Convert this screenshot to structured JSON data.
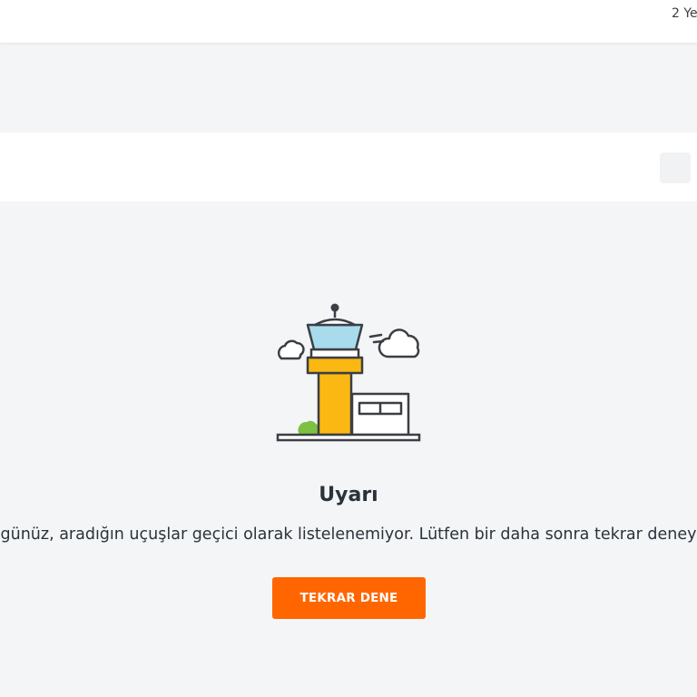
{
  "header": {
    "right_text": "2 Ye"
  },
  "warning": {
    "title": "Uyarı",
    "message": "günüz, aradığın uçuşlar geçici olarak listelenemiyor. Lütfen bir daha sonra tekrar deney",
    "retry_label": "TEKRAR DENE"
  },
  "illustration": {
    "icon": "control-tower-illustration"
  },
  "colors": {
    "background": "#f3f5f7",
    "accent": "#ff6600",
    "tower_yellow": "#fbb812",
    "tower_glass": "#a8dcec",
    "grass": "#7dc142",
    "outline": "#3a3f45"
  }
}
